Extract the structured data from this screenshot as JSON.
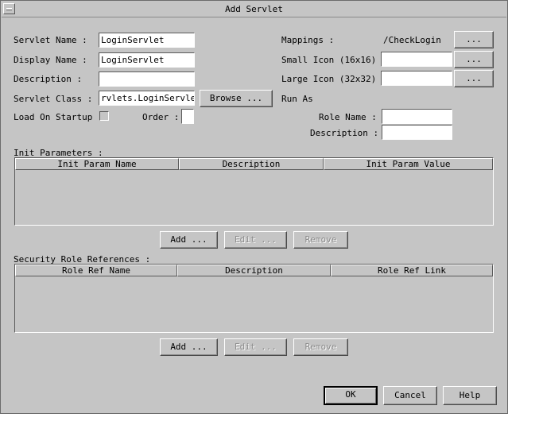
{
  "window": {
    "title": "Add Servlet"
  },
  "form": {
    "servlet_name": {
      "label": "Servlet Name :",
      "value": "LoginServlet"
    },
    "display_name": {
      "label": "Display Name :",
      "value": "LoginServlet"
    },
    "description": {
      "label": "Description :",
      "value": ""
    },
    "servlet_class": {
      "label": "Servlet Class :",
      "value": "rvlets.LoginServlet",
      "browse_label": "Browse ..."
    },
    "load_on_startup": {
      "label": "Load On Startup :",
      "order_label": "Order :",
      "order_value": ""
    },
    "mappings": {
      "label": "Mappings :",
      "value": "/CheckLogin",
      "button": "..."
    },
    "small_icon": {
      "label": "Small Icon (16x16) :",
      "value": "",
      "button": "..."
    },
    "large_icon": {
      "label": "Large Icon (32x32) :",
      "value": "",
      "button": "..."
    },
    "run_as": {
      "label": "Run As",
      "role_name_label": "Role Name :",
      "role_name_value": "",
      "description_label": "Description :",
      "description_value": ""
    }
  },
  "init_params": {
    "label": "Init Parameters :",
    "columns": [
      "Init Param Name",
      "Description",
      "Init Param Value"
    ],
    "rows": [],
    "add": "Add ...",
    "edit": "Edit ...",
    "remove": "Remove"
  },
  "security_roles": {
    "label": "Security Role References :",
    "columns": [
      "Role Ref Name",
      "Description",
      "Role Ref Link"
    ],
    "rows": [],
    "add": "Add ...",
    "edit": "Edit ...",
    "remove": "Remove"
  },
  "footer": {
    "ok": "OK",
    "cancel": "Cancel",
    "help": "Help"
  },
  "colors": {
    "dialog_bg": "#c5c5c5",
    "field_bg": "#ffffff",
    "disabled_text": "#8a8a8a"
  }
}
